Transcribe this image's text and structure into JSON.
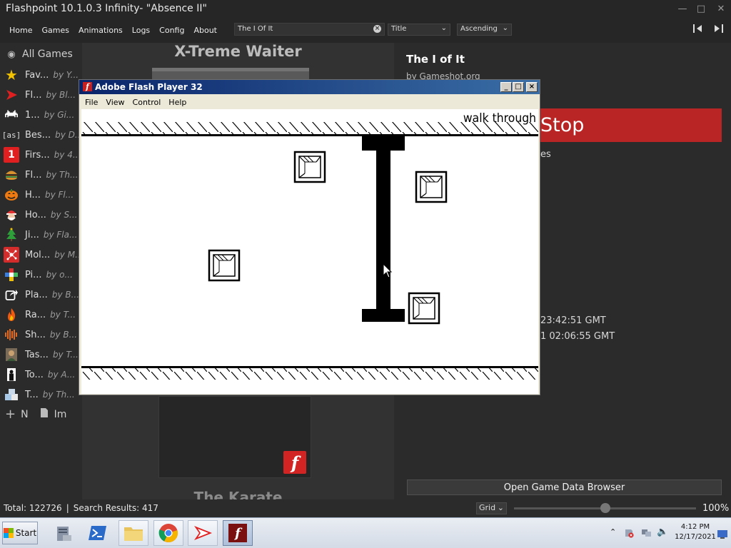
{
  "window": {
    "title": "Flashpoint 10.1.0.3 Infinity- \"Absence II\""
  },
  "nav": {
    "items": [
      "Home",
      "Games",
      "Animations",
      "Logs",
      "Config",
      "About"
    ],
    "search_value": "The I Of It",
    "sort_field": "Title",
    "sort_order": "Ascending"
  },
  "sidebar": {
    "all_games": "All Games",
    "playlists": [
      {
        "name": "Fav...",
        "by": "by Y...",
        "icon": "star-icon",
        "color": "#f2c200"
      },
      {
        "name": "Fl...",
        "by": "by Bl...",
        "icon": "flashpoint-arrow-icon",
        "color": "#e02020"
      },
      {
        "name": "1...",
        "by": "by Gi...",
        "icon": "space-invader-icon",
        "color": "#ffffff"
      },
      {
        "name": "Bes...",
        "by": "by D...",
        "icon": "as-icon",
        "color": "#dddddd"
      },
      {
        "name": "Firs...",
        "by": "by 4...",
        "icon": "number-one-icon",
        "color": "#e02020"
      },
      {
        "name": "Fl...",
        "by": "by Th...",
        "icon": "burger-icon",
        "color": "#d9912f"
      },
      {
        "name": "H...",
        "by": "by Fl...",
        "icon": "pumpkin-icon",
        "color": "#f07a10"
      },
      {
        "name": "Ho...",
        "by": "by S...",
        "icon": "santa-icon",
        "color": "#e03030"
      },
      {
        "name": "Ji...",
        "by": "by Fla...",
        "icon": "christmas-tree-icon",
        "color": "#2e9e3a"
      },
      {
        "name": "Mol...",
        "by": "by M...",
        "icon": "molecule-icon",
        "color": "#d42b2b"
      },
      {
        "name": "Pi...",
        "by": "by o...",
        "icon": "pixel-cross-icon",
        "color": "#3fbf5f"
      },
      {
        "name": "Pla...",
        "by": "by B...",
        "icon": "share-arrow-icon",
        "color": "#ffffff"
      },
      {
        "name": "Ra...",
        "by": "by T...",
        "icon": "flame-icon",
        "color": "#f05a10"
      },
      {
        "name": "Sh...",
        "by": "by B...",
        "icon": "soundwave-icon",
        "color": "#e06a20"
      },
      {
        "name": "Tas...",
        "by": "by T...",
        "icon": "character-icon",
        "color": "#c9a070"
      },
      {
        "name": "To...",
        "by": "by A...",
        "icon": "silhouette-icon",
        "color": "#ffffff"
      },
      {
        "name": "T...",
        "by": "by Th...",
        "icon": "blocks-icon",
        "color": "#a8c8e8"
      }
    ],
    "new_label": "N",
    "import_label": "Im"
  },
  "grid": {
    "card_title": "X-Treme Waiter",
    "next_card_title": "The Karate"
  },
  "details": {
    "title": "The I of It",
    "by": "by Gameshot.org",
    "stop_label": "Stop",
    "frag_es": "es",
    "frag_date1": "23:42:51 GMT",
    "frag_date2": "1 02:06:55 GMT",
    "open_browser": "Open Game Data Browser"
  },
  "status": {
    "total": "Total: 122726",
    "separator": "|",
    "results": "Search Results: 417",
    "view_mode": "Grid",
    "zoom": "100%",
    "zoom_level": 0.5
  },
  "flash": {
    "title": "Adobe Flash Player 32",
    "menu": [
      "File",
      "View",
      "Control",
      "Help"
    ],
    "walk_text": "walk through"
  },
  "taskbar": {
    "start_label": "Start",
    "time": "4:12 PM",
    "date": "12/17/2021"
  }
}
